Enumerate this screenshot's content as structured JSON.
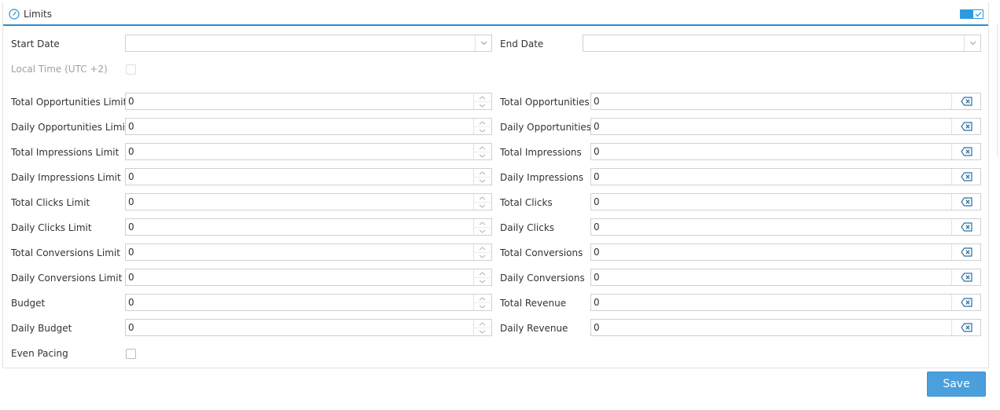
{
  "panel": {
    "title": "Limits",
    "title_icon": "clock-icon",
    "toggle_state": "on",
    "toggle_icon": "check-icon",
    "accent_color": "#2d8fd0"
  },
  "dates": {
    "start_label": "Start Date",
    "start_value": "",
    "end_label": "End Date",
    "end_value": "",
    "local_time_label": "Local Time (UTC +2)",
    "local_time_checked": false
  },
  "limits": [
    {
      "label": "Total Opportunities Limit",
      "value": "0",
      "right_label": "Total Opportunities",
      "right_value": "0"
    },
    {
      "label": "Daily Opportunities Limit",
      "value": "0",
      "right_label": "Daily Opportunities",
      "right_value": "0"
    },
    {
      "label": "Total Impressions Limit",
      "value": "0",
      "right_label": "Total Impressions",
      "right_value": "0"
    },
    {
      "label": "Daily Impressions Limit",
      "value": "0",
      "right_label": "Daily Impressions",
      "right_value": "0"
    },
    {
      "label": "Total Clicks Limit",
      "value": "0",
      "right_label": "Total Clicks",
      "right_value": "0"
    },
    {
      "label": "Daily Clicks Limit",
      "value": "0",
      "right_label": "Daily Clicks",
      "right_value": "0"
    },
    {
      "label": "Total Conversions Limit",
      "value": "0",
      "right_label": "Total Conversions",
      "right_value": "0"
    },
    {
      "label": "Daily Conversions Limit",
      "value": "0",
      "right_label": "Daily Conversions",
      "right_value": "0"
    },
    {
      "label": "Budget",
      "value": "0",
      "right_label": "Total Revenue",
      "right_value": "0"
    },
    {
      "label": "Daily Budget",
      "value": "0",
      "right_label": "Daily Revenue",
      "right_value": "0"
    }
  ],
  "even_pacing": {
    "label": "Even Pacing",
    "checked": false
  },
  "save_label": "Save",
  "save_color": "#4a9fdc"
}
